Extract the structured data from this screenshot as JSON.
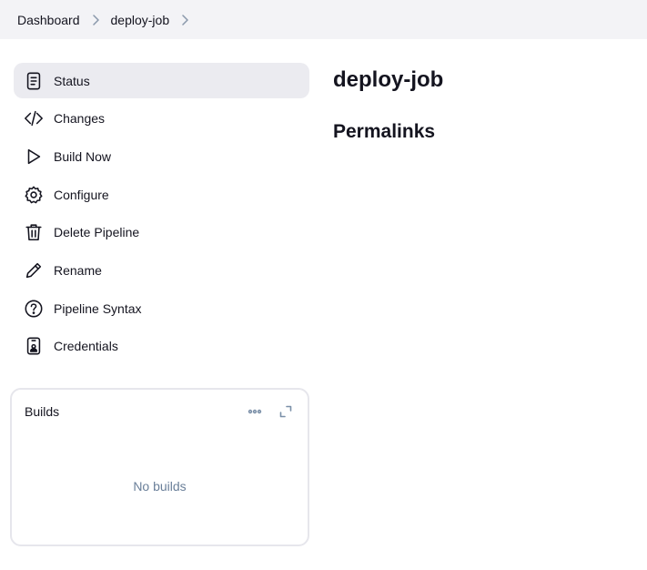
{
  "breadcrumb": {
    "items": [
      {
        "label": "Dashboard"
      },
      {
        "label": "deploy-job"
      }
    ]
  },
  "sidebar": {
    "items": [
      {
        "label": "Status",
        "icon": "document-icon",
        "active": true
      },
      {
        "label": "Changes",
        "icon": "code-icon"
      },
      {
        "label": "Build Now",
        "icon": "play-icon"
      },
      {
        "label": "Configure",
        "icon": "gear-icon"
      },
      {
        "label": "Delete Pipeline",
        "icon": "trash-icon"
      },
      {
        "label": "Rename",
        "icon": "pencil-icon"
      },
      {
        "label": "Pipeline Syntax",
        "icon": "help-circle-icon"
      },
      {
        "label": "Credentials",
        "icon": "credentials-icon"
      }
    ]
  },
  "builds": {
    "title": "Builds",
    "empty_text": "No builds",
    "actions": [
      "more-icon",
      "expand-icon"
    ]
  },
  "main": {
    "title": "deploy-job",
    "permalinks_heading": "Permalinks"
  },
  "colors": {
    "breadcrumb_bg": "#f3f3f6",
    "active_task_bg": "#ebebf0",
    "text": "#14141f",
    "muted": "#6a7f99",
    "card_border": "#e6e6ec"
  }
}
